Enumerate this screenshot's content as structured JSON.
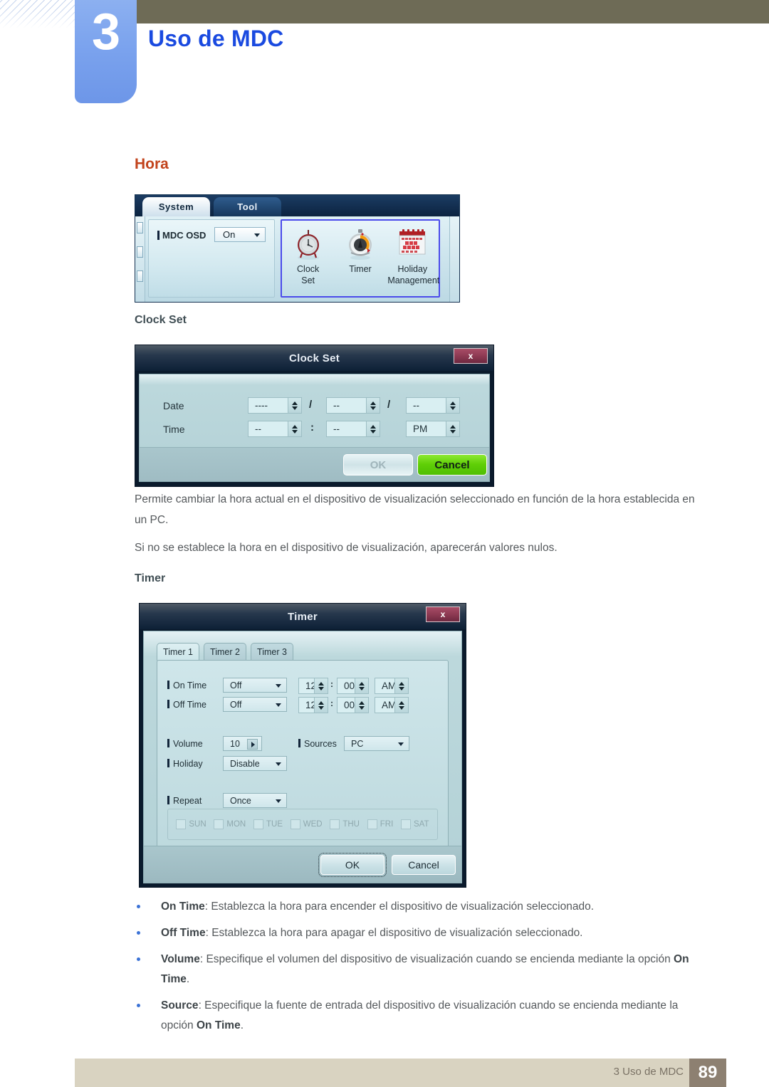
{
  "page": {
    "chapter_number": "3",
    "chapter_title": "Uso de MDC",
    "footer_text": "3 Uso de MDC",
    "footer_page_number": "89",
    "accent_blue": "#1a4ae0",
    "accent_red": "#c2431c",
    "header_olive": "#6e6b56",
    "footer_band": "#d9d3c1",
    "footer_page_bg": "#8d8071"
  },
  "section": {
    "heading": "Hora",
    "clock_set_heading": "Clock Set",
    "timer_heading": "Timer",
    "paragraph_1": "Permite cambiar la hora actual en el dispositivo de visualización seleccionado en función de la hora establecida en un PC.",
    "paragraph_2": "Si no se establece la hora en el dispositivo de visualización, aparecerán valores nulos."
  },
  "ribbon": {
    "tabs": [
      {
        "label": "System",
        "active": true
      },
      {
        "label": "Tool",
        "active": false
      }
    ],
    "group_system": {
      "field_label": "MDC OSD",
      "combo_value": "On"
    },
    "group_time": {
      "selected": true,
      "highlight_color": "#4b4beb",
      "items": [
        {
          "icon": "clock-icon",
          "caption_line1": "Clock",
          "caption_line2": "Set"
        },
        {
          "icon": "timer-icon",
          "caption_line1": "Timer",
          "caption_line2": ""
        },
        {
          "icon": "calendar-icon",
          "caption_line1": "Holiday",
          "caption_line2": "Management"
        }
      ]
    }
  },
  "clock_set_dialog": {
    "title": "Clock Set",
    "close_label": "x",
    "date_label": "Date",
    "time_label": "Time",
    "date_year": "----",
    "date_month": "--",
    "date_day": "--",
    "date_sep_1": "/",
    "date_sep_2": "/",
    "time_hour": "--",
    "time_minute": "--",
    "time_meridiem": "PM",
    "time_sep": ":",
    "ok_label": "OK",
    "cancel_label": "Cancel",
    "cancel_color": "#5fcf06"
  },
  "timer_dialog": {
    "title": "Timer",
    "close_label": "x",
    "tabs": [
      {
        "label": "Timer 1",
        "active": true
      },
      {
        "label": "Timer 2",
        "active": false
      },
      {
        "label": "Timer 3",
        "active": false
      }
    ],
    "on_time": {
      "label": "On Time",
      "mode": "Off",
      "hour": "12",
      "minute": "00",
      "meridiem": "AM",
      "sep": ":"
    },
    "off_time": {
      "label": "Off Time",
      "mode": "Off",
      "hour": "12",
      "minute": "00",
      "meridiem": "AM",
      "sep": ":"
    },
    "volume": {
      "label": "Volume",
      "value": "10"
    },
    "sources": {
      "label": "Sources",
      "value": "PC"
    },
    "holiday": {
      "label": "Holiday",
      "value": "Disable"
    },
    "repeat": {
      "label": "Repeat",
      "value": "Once"
    },
    "days": [
      {
        "label": "SUN",
        "checked": false
      },
      {
        "label": "MON",
        "checked": false
      },
      {
        "label": "TUE",
        "checked": false
      },
      {
        "label": "WED",
        "checked": false
      },
      {
        "label": "THU",
        "checked": false
      },
      {
        "label": "FRI",
        "checked": false
      },
      {
        "label": "SAT",
        "checked": false
      }
    ],
    "ok_label": "OK",
    "cancel_label": "Cancel"
  },
  "bullets": [
    {
      "term": "On Time",
      "rest": ": Establezca la hora para encender el dispositivo de visualización seleccionado."
    },
    {
      "term": "Off Time",
      "rest": ": Establezca la hora para apagar el dispositivo de visualización seleccionado."
    },
    {
      "term": "Volume",
      "rest": ": Especifique el volumen del dispositivo de visualización cuando se encienda mediante la opción ",
      "term2": "On Time",
      "tail": "."
    },
    {
      "term": "Source",
      "rest": ": Especifique la fuente de entrada del dispositivo de visualización cuando se encienda mediante la opción ",
      "term2": "On Time",
      "tail": "."
    }
  ]
}
